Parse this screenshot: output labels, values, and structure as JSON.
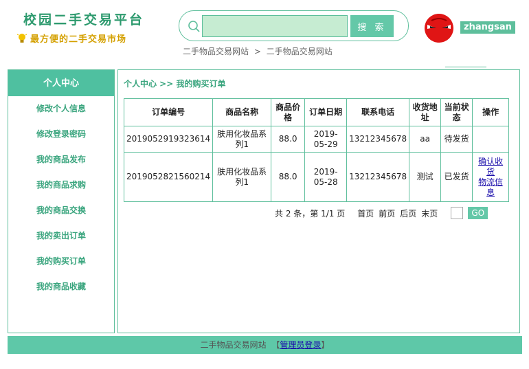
{
  "header": {
    "title": "校园二手交易平台",
    "subtitle": "最方便的二手交易市场",
    "bulb_icon": "lightbulb-icon"
  },
  "search": {
    "placeholder": "",
    "value": "",
    "button_label": "搜 索"
  },
  "top_breadcrumb": {
    "home": "二手物品交易网站",
    "separator": ">",
    "current": "二手物品交易网站"
  },
  "user": {
    "username": "zhangsan",
    "avatar_color": "#e01515"
  },
  "sidebar": {
    "header": "个人中心",
    "items": [
      {
        "label": "修改个人信息"
      },
      {
        "label": "修改登录密码"
      },
      {
        "label": "我的商品发布"
      },
      {
        "label": "我的商品求购"
      },
      {
        "label": "我的商品交换"
      },
      {
        "label": "我的卖出订单"
      },
      {
        "label": "我的购买订单"
      },
      {
        "label": "我的商品收藏"
      }
    ]
  },
  "main": {
    "breadcrumb": "个人中心 >> 我的购买订单",
    "table": {
      "headers": [
        "订单编号",
        "商品名称",
        "商品价格",
        "订单日期",
        "联系电话",
        "收货地址",
        "当前状态",
        "操作"
      ],
      "rows": [
        {
          "order_no": "2019052919323614",
          "product": "肤用化妆品系列1",
          "price": "88.0",
          "date": "2019-05-29",
          "phone": "13212345678",
          "address": "aa",
          "status": "待发货",
          "actions": []
        },
        {
          "order_no": "2019052821560214",
          "product": "肤用化妆品系列1",
          "price": "88.0",
          "date": "2019-05-28",
          "phone": "13212345678",
          "address": "测试",
          "status": "已发货",
          "actions": [
            "确认收货",
            "物流信息"
          ]
        }
      ]
    },
    "pager": {
      "summary": "共 2 条，第 1/1 页",
      "first": "首页",
      "prev": "前页",
      "next": "后页",
      "last": "末页",
      "go_label": "GO",
      "page_input": ""
    }
  },
  "footer": {
    "site_name": "二手物品交易网站",
    "bracket_open": "【",
    "admin_login": "管理员登录",
    "bracket_close": "】"
  },
  "colors": {
    "accent": "#5ebf9c",
    "sidebar_header": "#4fc0a0",
    "title_green": "#2d9a6e",
    "subtitle_gold": "#d4a000",
    "link_blue": "#1a0dab"
  }
}
